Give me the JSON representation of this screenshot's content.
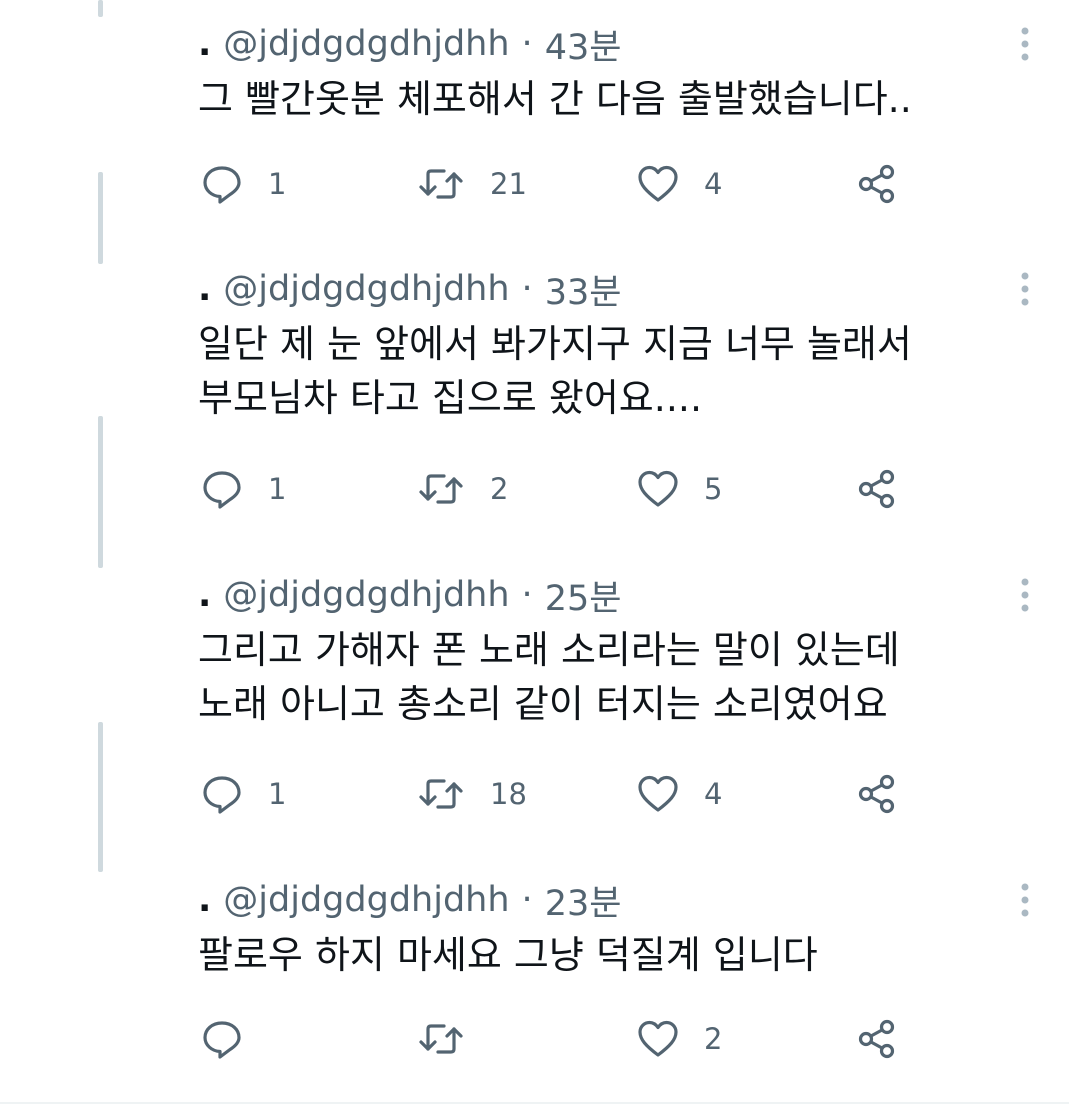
{
  "tweets": [
    {
      "name": ".",
      "handle": "@jdjdgdgdhjdhh",
      "separator": "·",
      "time": "43분",
      "text": "그 빨간옷분 체포해서 간 다음 출발했습니다..",
      "replies": "1",
      "retweets": "21",
      "likes": "4"
    },
    {
      "name": ".",
      "handle": "@jdjdgdgdhjdhh",
      "separator": "·",
      "time": "33분",
      "text": "일단 제 눈 앞에서 봐가지구 지금 너무 놀래서\n부모님차 타고 집으로 왔어요....",
      "replies": "1",
      "retweets": "2",
      "likes": "5"
    },
    {
      "name": ".",
      "handle": "@jdjdgdgdhjdhh",
      "separator": "·",
      "time": "25분",
      "text": "그리고 가해자 폰 노래 소리라는 말이 있는데\n노래 아니고 총소리 같이 터지는 소리였어요",
      "replies": "1",
      "retweets": "18",
      "likes": "4"
    },
    {
      "name": ".",
      "handle": "@jdjdgdgdhjdhh",
      "separator": "·",
      "time": "23분",
      "text": "팔로우 하지 마세요 그냥 덕질계 입니다",
      "replies": "",
      "retweets": "",
      "likes": "2"
    }
  ],
  "icons": {
    "more": "more-vertical-icon",
    "reply": "reply-icon",
    "retweet": "retweet-icon",
    "like": "heart-icon",
    "share": "share-icon"
  },
  "colors": {
    "text": "#0f1419",
    "secondary": "#536471",
    "thread_line": "#cfd9de",
    "divider": "#eff3f4"
  }
}
